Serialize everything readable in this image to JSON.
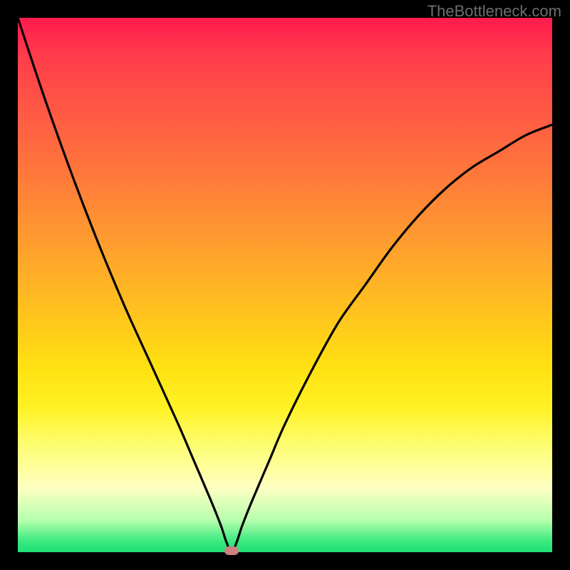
{
  "watermark": "TheBottleneck.com",
  "colors": {
    "frame": "#000000",
    "curve_stroke": "#000000",
    "marker_fill": "#cf8181",
    "gradient_top": "#ff1a4e",
    "gradient_bottom": "#1fe076"
  },
  "chart_data": {
    "type": "line",
    "title": "",
    "xlabel": "",
    "ylabel": "",
    "xlim": [
      0,
      100
    ],
    "ylim": [
      0,
      100
    ],
    "x": [
      0,
      5,
      10,
      15,
      20,
      25,
      30,
      33,
      36,
      38,
      39,
      40,
      41,
      42,
      44,
      47,
      50,
      55,
      60,
      65,
      70,
      75,
      80,
      85,
      90,
      95,
      100
    ],
    "y": [
      100,
      85,
      71,
      58,
      46,
      35,
      24,
      17,
      10,
      5,
      2,
      0,
      2,
      5,
      10,
      17,
      24,
      34,
      43,
      50,
      57,
      63,
      68,
      72,
      75,
      78,
      80
    ],
    "marker": {
      "x": 40,
      "y": 0
    },
    "notes": "V-shaped bottleneck curve; minimum (0%) near x≈40. Left branch steeper, right branch asymptotes around 80%. Axes unlabeled; values estimated from gradient bands (top=red=100% bottleneck, bottom=green=0%)."
  }
}
